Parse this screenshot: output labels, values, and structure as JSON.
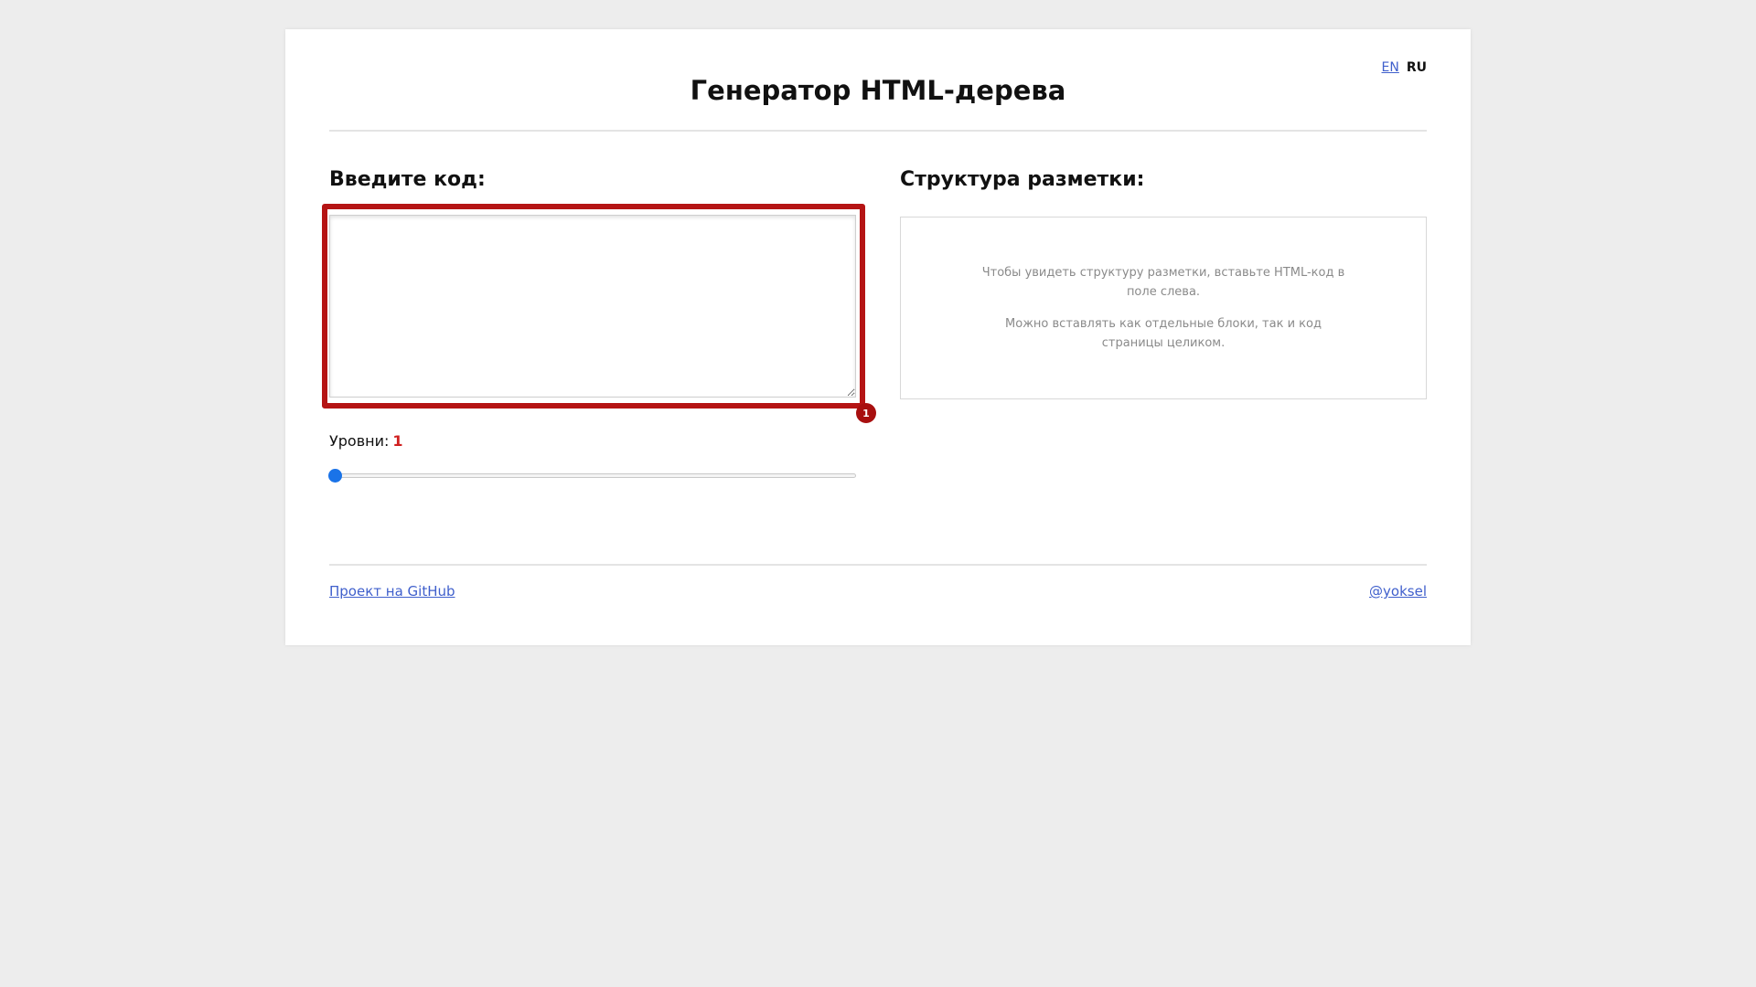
{
  "header": {
    "title": "Генератор HTML-дерева",
    "languages": [
      {
        "label": "EN",
        "active": false
      },
      {
        "label": "RU",
        "active": true
      }
    ]
  },
  "input_panel": {
    "heading": "Введите код:",
    "code_value": "",
    "annotation_badge": "1",
    "levels_label": "Уровни:",
    "levels_value": "1",
    "slider": {
      "min": 1,
      "max": 20,
      "value": 1
    }
  },
  "structure_panel": {
    "heading": "Структура разметки:",
    "hint_line1": "Чтобы увидеть структуру разметки, вставьте HTML-код в поле слева.",
    "hint_line2": "Можно вставлять как отдельные блоки, так и код страницы целиком."
  },
  "footer": {
    "github_link": "Проект на GitHub",
    "author_link": "@yoksel"
  },
  "colors": {
    "page_bg": "#ededed",
    "link": "#3f5fcc",
    "highlight": "#b51414",
    "level_number": "#d01f1f",
    "slider_thumb": "#1a73e8"
  }
}
